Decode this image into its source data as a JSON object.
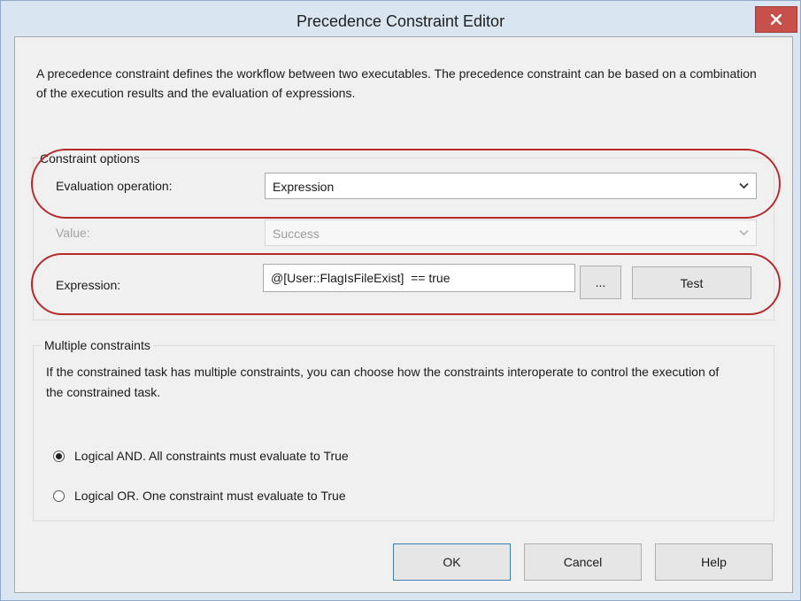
{
  "window": {
    "title": "Precedence Constraint Editor",
    "close_icon": "close-icon"
  },
  "description": "A precedence constraint defines the workflow between two executables. The precedence constraint can be based on a combination of the execution results and the evaluation of expressions.",
  "constraint_options": {
    "group_title": "Constraint options",
    "evaluation_operation": {
      "label": "Evaluation operation:",
      "value": "Expression"
    },
    "value": {
      "label": "Value:",
      "value": "Success",
      "enabled": false
    },
    "expression": {
      "label": "Expression:",
      "value": "@[User::FlagIsFileExist]  == true",
      "browse_label": "...",
      "test_label": "Test"
    }
  },
  "multiple_constraints": {
    "group_title": "Multiple constraints",
    "description": "If the constrained task has multiple constraints, you can choose how the constraints interoperate to control the execution of the constrained task.",
    "options": [
      {
        "label": "Logical AND. All constraints must evaluate to True",
        "checked": true
      },
      {
        "label": "Logical OR. One constraint must evaluate to True",
        "checked": false
      }
    ]
  },
  "buttons": {
    "ok": "OK",
    "cancel": "Cancel",
    "help": "Help"
  },
  "colors": {
    "frame": "#d9e6f2",
    "close_button": "#c7504a",
    "highlight": "#b52a2a",
    "default_button_border": "#3c7fb1"
  }
}
